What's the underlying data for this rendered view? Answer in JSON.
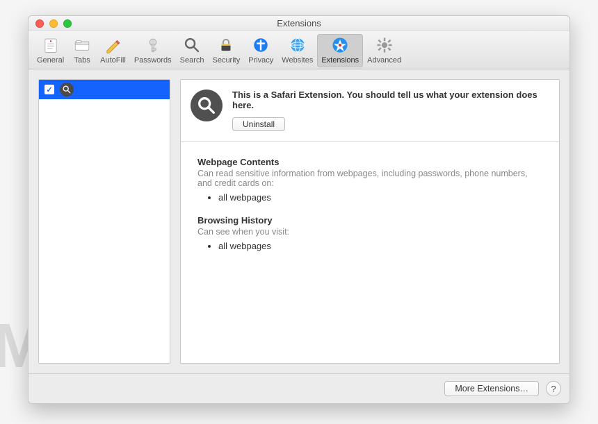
{
  "window": {
    "title": "Extensions"
  },
  "toolbar": {
    "items": [
      {
        "label": "General"
      },
      {
        "label": "Tabs"
      },
      {
        "label": "AutoFill"
      },
      {
        "label": "Passwords"
      },
      {
        "label": "Search"
      },
      {
        "label": "Security"
      },
      {
        "label": "Privacy"
      },
      {
        "label": "Websites"
      },
      {
        "label": "Extensions"
      },
      {
        "label": "Advanced"
      }
    ]
  },
  "extension": {
    "description": "This is a Safari Extension. You should tell us what your extension does here.",
    "uninstall_label": "Uninstall"
  },
  "permissions": {
    "webpage_title": "Webpage Contents",
    "webpage_desc": "Can read sensitive information from webpages, including passwords, phone numbers, and credit cards on:",
    "webpage_item": "all webpages",
    "history_title": "Browsing History",
    "history_desc": "Can see when you visit:",
    "history_item": "all webpages"
  },
  "footer": {
    "more_label": "More Extensions…",
    "help_label": "?"
  },
  "watermark": "MALWARETIPS"
}
